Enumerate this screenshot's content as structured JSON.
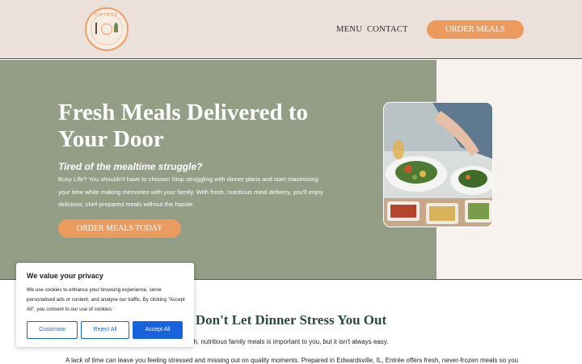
{
  "header": {
    "logo": {
      "brand": "ENTRÉE"
    },
    "nav": [
      {
        "label": "MENU"
      },
      {
        "label": "CONTACT"
      }
    ],
    "order_button": "ORDER MEALS"
  },
  "hero": {
    "title": "Fresh Meals Delivered to Your Door",
    "subtitle": "Tired of the mealtime struggle?",
    "body": "Busy Life? You shouldn't have to choose! Stop struggling with dinner plans and start maximizing your time while making memories with your family. With fresh, nutritious meal delivery, you'll enjoy delicious, chef-prepared meals without the hassle.",
    "cta": "ORDER MEALS TODAY"
  },
  "content": {
    "heading": "Don't Let Dinner Stress You Out",
    "para1": "ng fresh, nutritious family meals is important to you, but it isn't always easy.",
    "para2": "A lack of time can leave you feeling stressed and missing out on quality moments. Prepared in Edwardsville, IL, Entrée offers fresh, never-frozen meals so you"
  },
  "cookie": {
    "title": "We value your privacy",
    "text": "We use cookies to enhance your browsing experience, serve personalised ads or content, and analyse our traffic. By clicking \"Accept All\", you consent to our use of cookies.",
    "customise": "Customise",
    "reject": "Reject All",
    "accept": "Accept All"
  },
  "colors": {
    "accent_orange": "#eb9b5e",
    "hero_green": "#949d86",
    "header_bg": "#ebe1da",
    "cookie_blue": "#1863dc"
  }
}
